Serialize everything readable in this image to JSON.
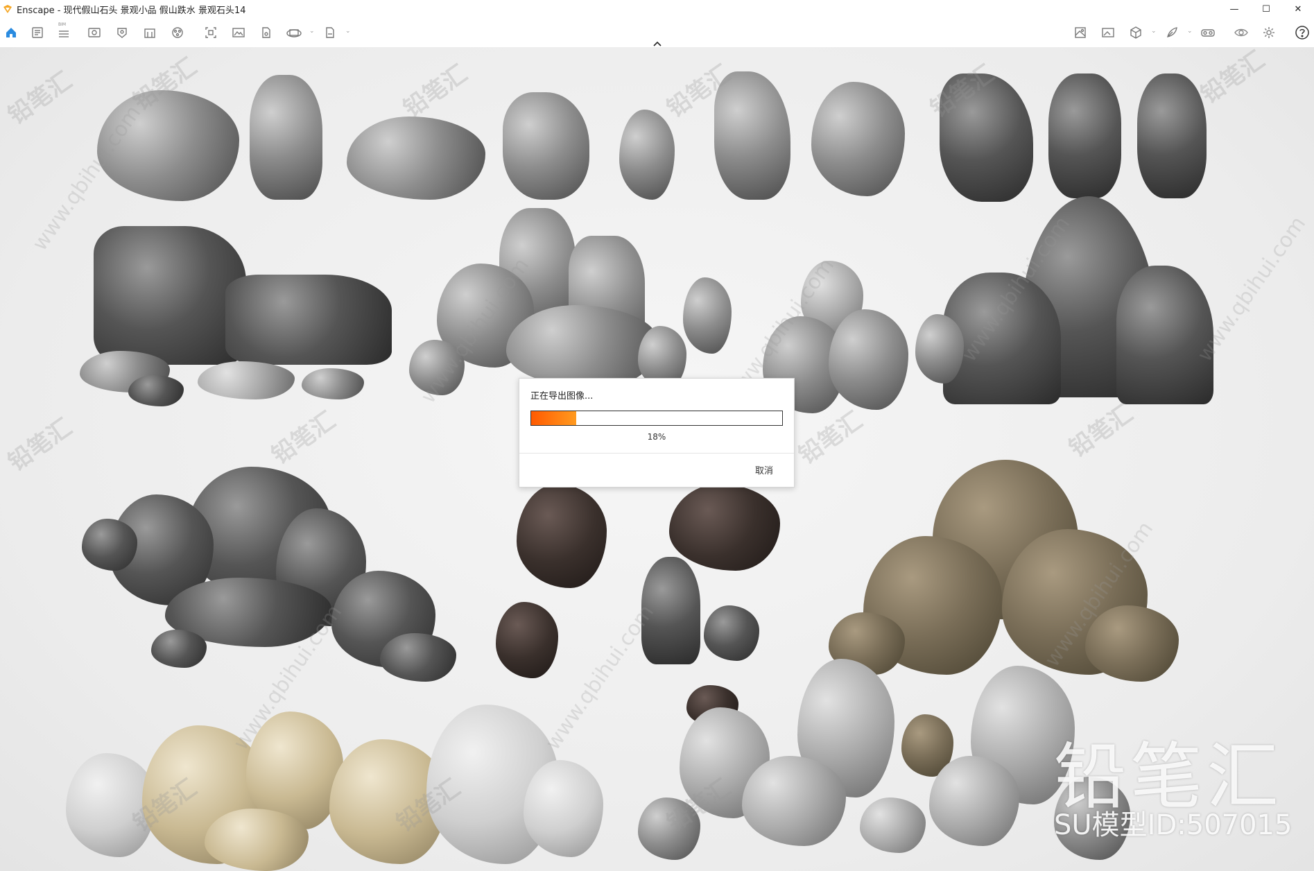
{
  "window": {
    "title": "Enscape - 现代假山石头 景观小品 假山跌水 景观石头14",
    "min_glyph": "—",
    "max_glyph": "☐",
    "close_glyph": "✕"
  },
  "toolbar": {
    "bim_label": "BIM",
    "icons_left": [
      "home-icon",
      "document-list-icon",
      "bim-icon",
      "preview-window-icon",
      "visual-settings-icon",
      "building-icon",
      "asset-library-icon",
      "views-icon",
      "image-icon",
      "material-icon",
      "360-panorama-icon",
      "exe-export-icon"
    ],
    "icons_right": [
      "map-icon",
      "screenshot-icon",
      "cube-icon",
      "feather-icon",
      "vr-icon",
      "eye-icon",
      "settings-icon",
      "help-icon"
    ]
  },
  "export_dialog": {
    "title": "正在导出图像...",
    "progress": 0.18,
    "progress_label": "18%",
    "cancel_label": "取消",
    "accent": "#ff6a00"
  },
  "watermark": {
    "brand": "铅笔汇",
    "model_id": "SU模型ID:507015",
    "tile_text": "铅笔汇",
    "url_text": "www.qbihui.com"
  }
}
